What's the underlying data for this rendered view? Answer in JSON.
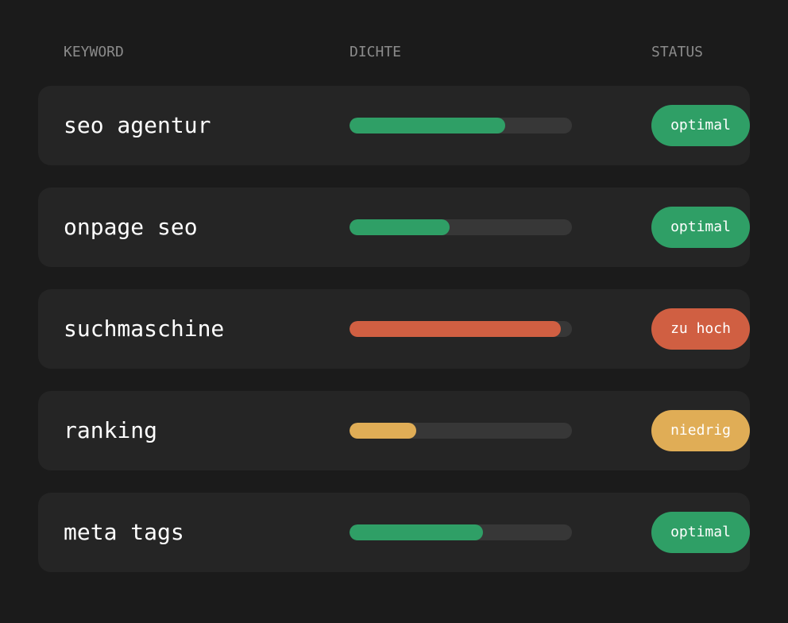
{
  "header": {
    "keyword": "KEYWORD",
    "density": "DICHTE",
    "status": "STATUS"
  },
  "colors": {
    "optimal": "#2f9f66",
    "zu hoch": "#d05f42",
    "niedrig": "#e0ad56"
  },
  "rows": [
    {
      "keyword": "seo agentur",
      "density": 0.7,
      "status": "optimal"
    },
    {
      "keyword": "onpage seo",
      "density": 0.45,
      "status": "optimal"
    },
    {
      "keyword": "suchmaschine",
      "density": 0.95,
      "status": "zu hoch"
    },
    {
      "keyword": "ranking",
      "density": 0.3,
      "status": "niedrig"
    },
    {
      "keyword": "meta tags",
      "density": 0.6,
      "status": "optimal"
    }
  ]
}
